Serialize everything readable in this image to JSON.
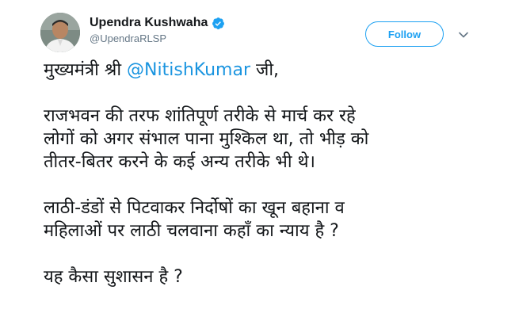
{
  "user": {
    "display_name": "Upendra Kushwaha",
    "handle": "@UpendraRLSP",
    "verified": true,
    "avatar_icon": "profile-photo"
  },
  "actions": {
    "follow_label": "Follow",
    "menu_icon": "chevron-down-icon"
  },
  "colors": {
    "accent": "#1da1f2",
    "mention": "#1b95e0",
    "text": "#14171a",
    "muted": "#657786"
  },
  "tweet": {
    "greeting_prefix": "मुख्यमंत्री श्री ",
    "greeting_mention": "@NitishKumar",
    "greeting_suffix": " जी,",
    "para2_lines": [
      "राजभवन की तरफ शांतिपूर्ण तरीके से मार्च कर रहे",
      "लोगों को अगर संभाल पाना मुश्किल था, तो भीड़ को",
      "तीतर-बितर करने के कई अन्य तरीके भी थे।"
    ],
    "para3_lines": [
      "लाठी-डंडों से पिटवाकर निर्दोषों का खून बहाना व",
      "महिलाओं पर लाठी चलवाना कहाँ का न्याय है ?"
    ],
    "para4": "यह कैसा सुशासन है ?"
  }
}
